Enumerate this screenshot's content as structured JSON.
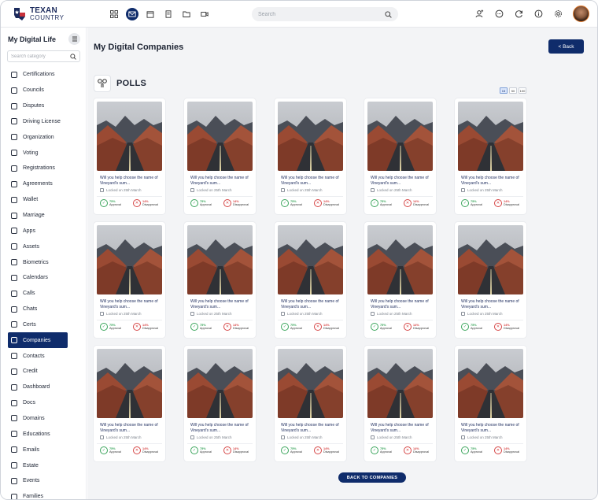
{
  "app": {
    "logo_line1": "TEXAN",
    "logo_line2": "COUNTRY",
    "brand_color": "#0f2c6b",
    "nav_icons": [
      "grid-icon",
      "mail-icon",
      "calendar-icon",
      "document-icon",
      "folder-icon",
      "video-icon"
    ],
    "active_nav": "mail-icon",
    "search_placeholder": "Search",
    "right_icons": [
      "user-add-icon",
      "chat-icon",
      "refresh-icon",
      "info-icon",
      "settings-icon"
    ]
  },
  "sidebar": {
    "title": "My Digital Life",
    "search_placeholder": "Search category",
    "items": [
      "Certifications",
      "Councils",
      "Disputes",
      "Driving License",
      "Organization",
      "Voting",
      "Registrations",
      "Agreements",
      "Wallet",
      "Marriage",
      "Apps",
      "Assets",
      "Biometrics",
      "Calendars",
      "Calls",
      "Chats",
      "Certs",
      "Companies",
      "Contacts",
      "Credit",
      "Dashboard",
      "Docs",
      "Domains",
      "Educations",
      "Emails",
      "Estate",
      "Events",
      "Families"
    ],
    "active_item": "Companies"
  },
  "main": {
    "page_title": "My Digital Companies",
    "back_label": "< Back",
    "section_title": "POLLS",
    "page_size_options": [
      "15",
      "50",
      "100"
    ],
    "page_size_selected": "15",
    "bottom_button": "BACK TO COMPANIES",
    "approve_color": "#3ba55c",
    "disapprove_color": "#d64545"
  },
  "polls": [
    {
      "question": "Will you help choose the name of  Vineyard's sum...",
      "locked": "Locked on 25th March",
      "approval": "75%",
      "approval_label": "Approval",
      "disapproval": "14%",
      "disapproval_label": "Disapproval"
    },
    {
      "question": "Will you help choose the name of  Vineyard's sum...",
      "locked": "Locked on 25th March",
      "approval": "75%",
      "approval_label": "Approval",
      "disapproval": "14%",
      "disapproval_label": "Disapproval"
    },
    {
      "question": "Will you help choose the name of  Vineyard's sum...",
      "locked": "Locked on 25th March",
      "approval": "75%",
      "approval_label": "Approval",
      "disapproval": "14%",
      "disapproval_label": "Disapproval"
    },
    {
      "question": "Will you help choose the name of  Vineyard's sum...",
      "locked": "Locked on 25th March",
      "approval": "75%",
      "approval_label": "Approval",
      "disapproval": "14%",
      "disapproval_label": "Disapproval"
    },
    {
      "question": "Will you help choose the name of  Vineyard's sum...",
      "locked": "Locked on 25th March",
      "approval": "75%",
      "approval_label": "Approval",
      "disapproval": "14%",
      "disapproval_label": "Disapproval"
    },
    {
      "question": "Will you help choose the name of  Vineyard's sum...",
      "locked": "Locked on 25th March",
      "approval": "75%",
      "approval_label": "Approval",
      "disapproval": "14%",
      "disapproval_label": "Disapproval"
    },
    {
      "question": "Will you help choose the name of  Vineyard's sum...",
      "locked": "Locked on 25th March",
      "approval": "75%",
      "approval_label": "Approval",
      "disapproval": "14%",
      "disapproval_label": "Disapproval"
    },
    {
      "question": "Will you help choose the name of  Vineyard's sum...",
      "locked": "Locked on 25th March",
      "approval": "75%",
      "approval_label": "Approval",
      "disapproval": "14%",
      "disapproval_label": "Disapproval"
    },
    {
      "question": "Will you help choose the name of  Vineyard's sum...",
      "locked": "Locked on 25th March",
      "approval": "75%",
      "approval_label": "Approval",
      "disapproval": "14%",
      "disapproval_label": "Disapproval"
    },
    {
      "question": "Will you help choose the name of  Vineyard's sum...",
      "locked": "Locked on 25th March",
      "approval": "75%",
      "approval_label": "Approval",
      "disapproval": "14%",
      "disapproval_label": "Disapproval"
    },
    {
      "question": "Will you help choose the name of  Vineyard's sum...",
      "locked": "Locked on 25th March",
      "approval": "75%",
      "approval_label": "Approval",
      "disapproval": "14%",
      "disapproval_label": "Disapproval"
    },
    {
      "question": "Will you help choose the name of  Vineyard's sum...",
      "locked": "Locked on 25th March",
      "approval": "75%",
      "approval_label": "Approval",
      "disapproval": "14%",
      "disapproval_label": "Disapproval"
    },
    {
      "question": "Will you help choose the name of  Vineyard's sum...",
      "locked": "Locked on 25th March",
      "approval": "75%",
      "approval_label": "Approval",
      "disapproval": "14%",
      "disapproval_label": "Disapproval"
    },
    {
      "question": "Will you help choose the name of  Vineyard's sum...",
      "locked": "Locked on 25th March",
      "approval": "75%",
      "approval_label": "Approval",
      "disapproval": "14%",
      "disapproval_label": "Disapproval"
    },
    {
      "question": "Will you help choose the name of  Vineyard's sum...",
      "locked": "Locked on 25th March",
      "approval": "75%",
      "approval_label": "Approval",
      "disapproval": "14%",
      "disapproval_label": "Disapproval"
    }
  ]
}
